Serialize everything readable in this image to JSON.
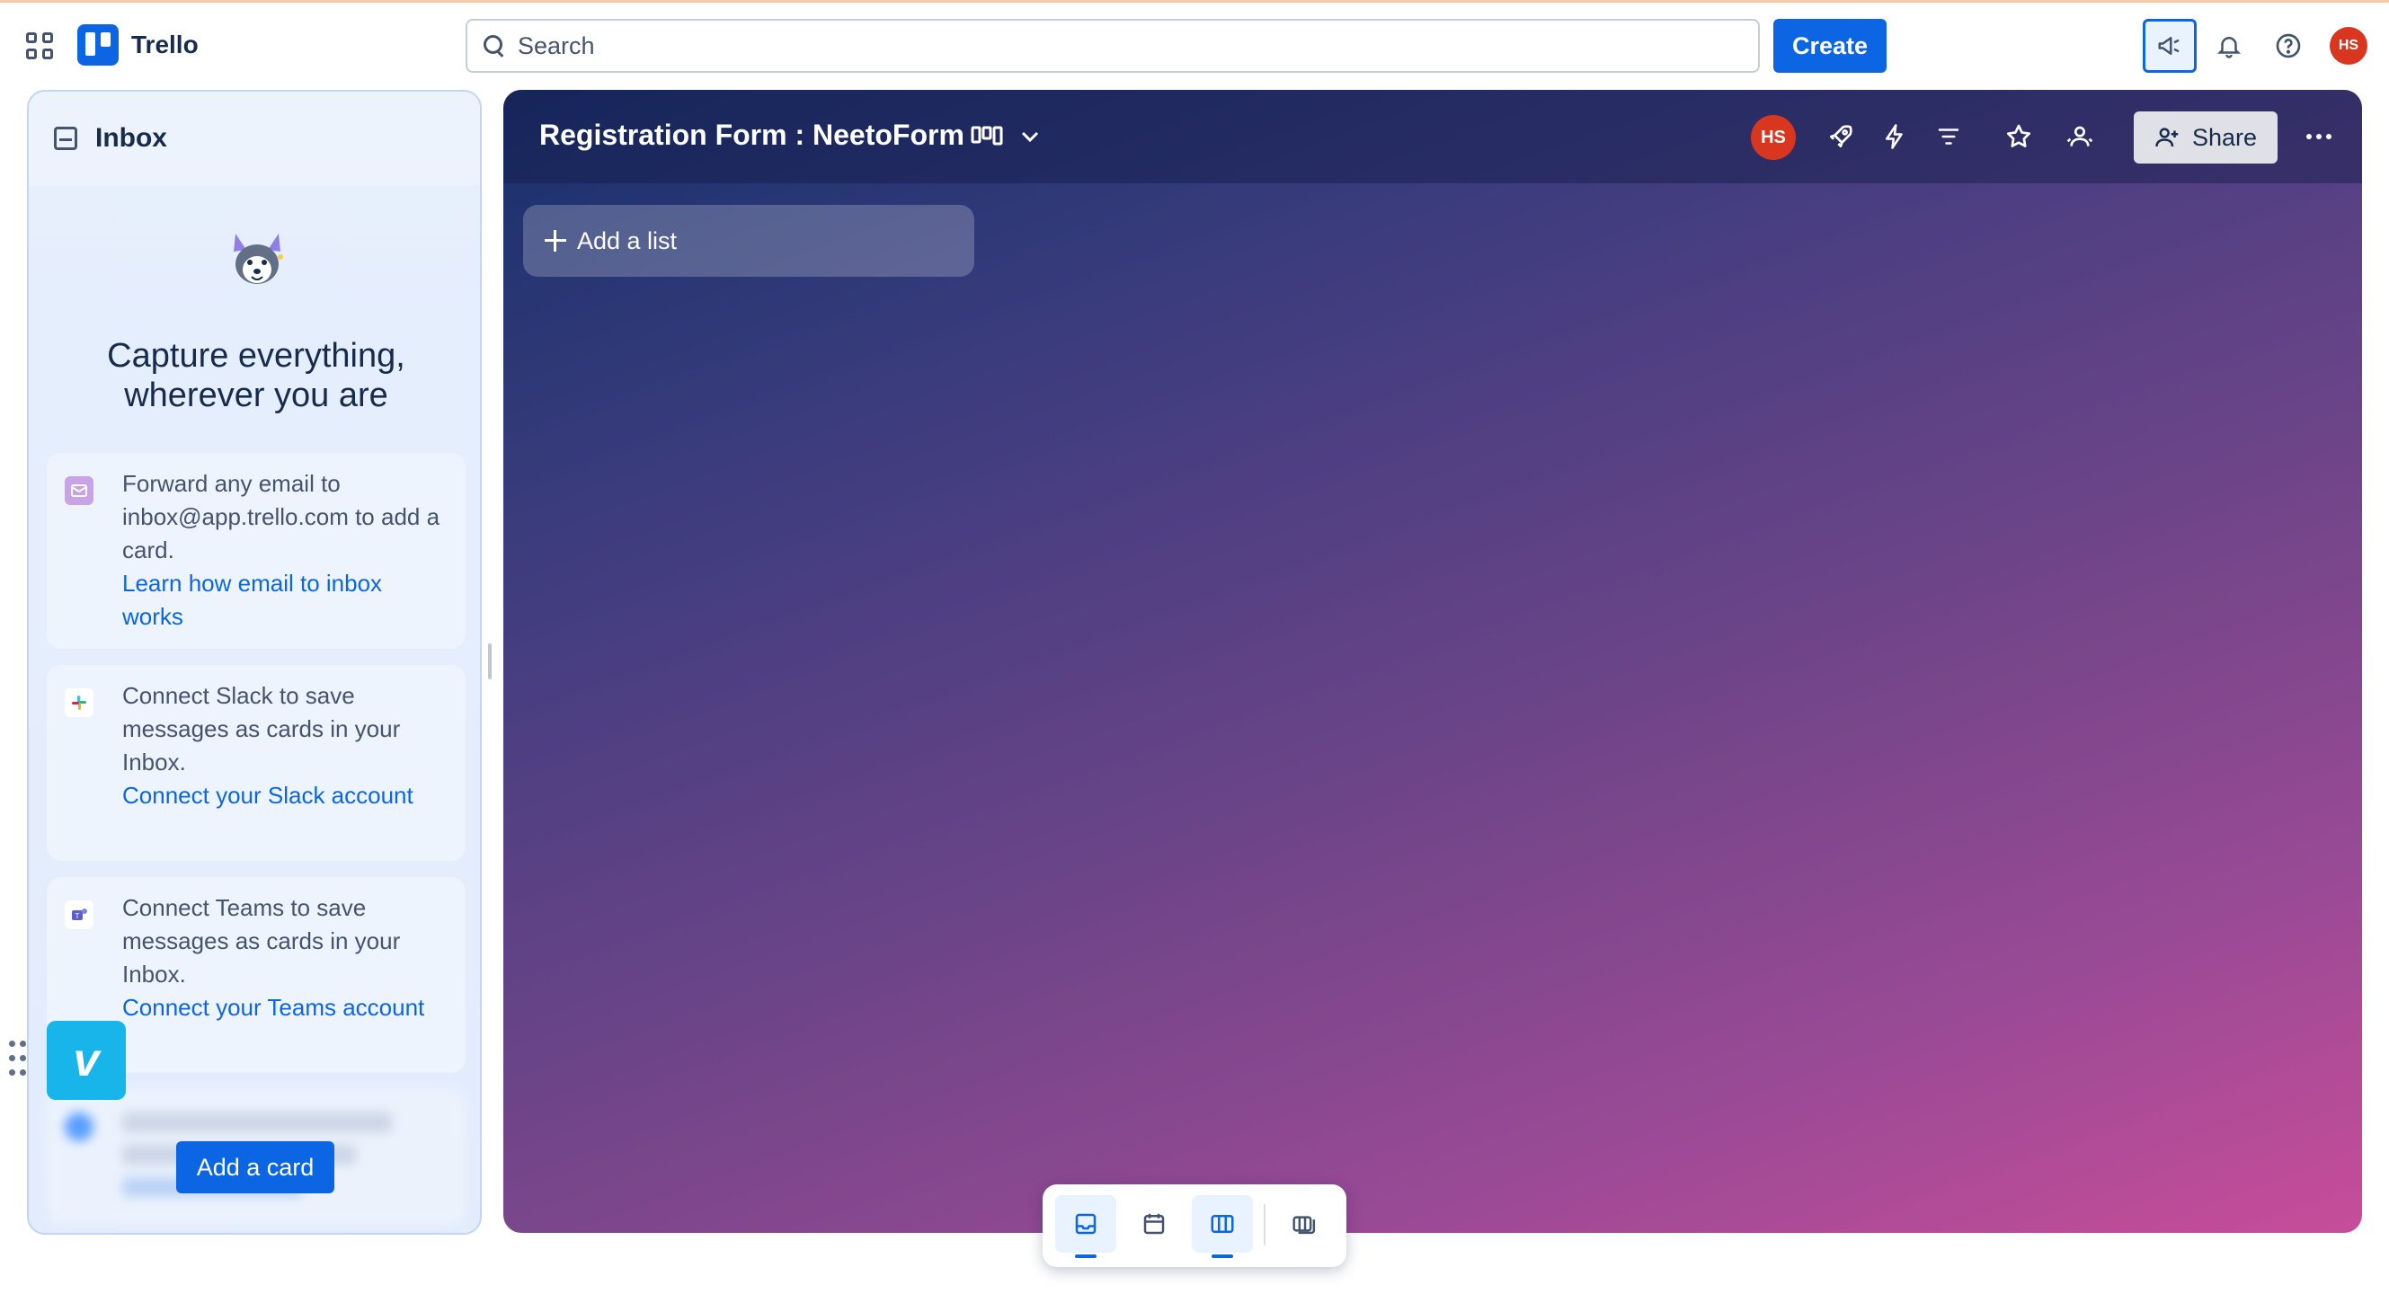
{
  "app": {
    "name": "Trello"
  },
  "search": {
    "placeholder": "Search"
  },
  "header": {
    "create_label": "Create",
    "user_initials": "HS"
  },
  "inbox": {
    "title": "Inbox",
    "headline": "Capture everything, wherever you are",
    "cards": [
      {
        "text": "Forward any email to inbox@app.trello.com to add a card.",
        "link": "Learn how email to inbox works"
      },
      {
        "text": "Connect Slack to save messages as cards in your Inbox.",
        "link": "Connect your Slack account"
      },
      {
        "text": "Connect Teams to save messages as cards in your Inbox.",
        "link": "Connect your Teams account"
      }
    ],
    "add_card_label": "Add a card"
  },
  "board": {
    "title": "Registration Form : NeetoForm",
    "member_initials": "HS",
    "share_label": "Share",
    "add_list_label": "Add a list"
  },
  "colors": {
    "accent": "#0c66e4",
    "avatar": "#d9361f",
    "vimeo": "#17b5ea"
  },
  "icons": [
    "apps-grid-icon",
    "search-icon",
    "megaphone-icon",
    "bell-icon",
    "help-icon",
    "inbox-icon",
    "rocket-icon",
    "lightning-icon",
    "filter-icon",
    "star-icon",
    "team-icon",
    "add-person-icon",
    "more-icon",
    "inbox-view-icon",
    "calendar-icon",
    "board-view-icon",
    "switch-boards-icon"
  ]
}
